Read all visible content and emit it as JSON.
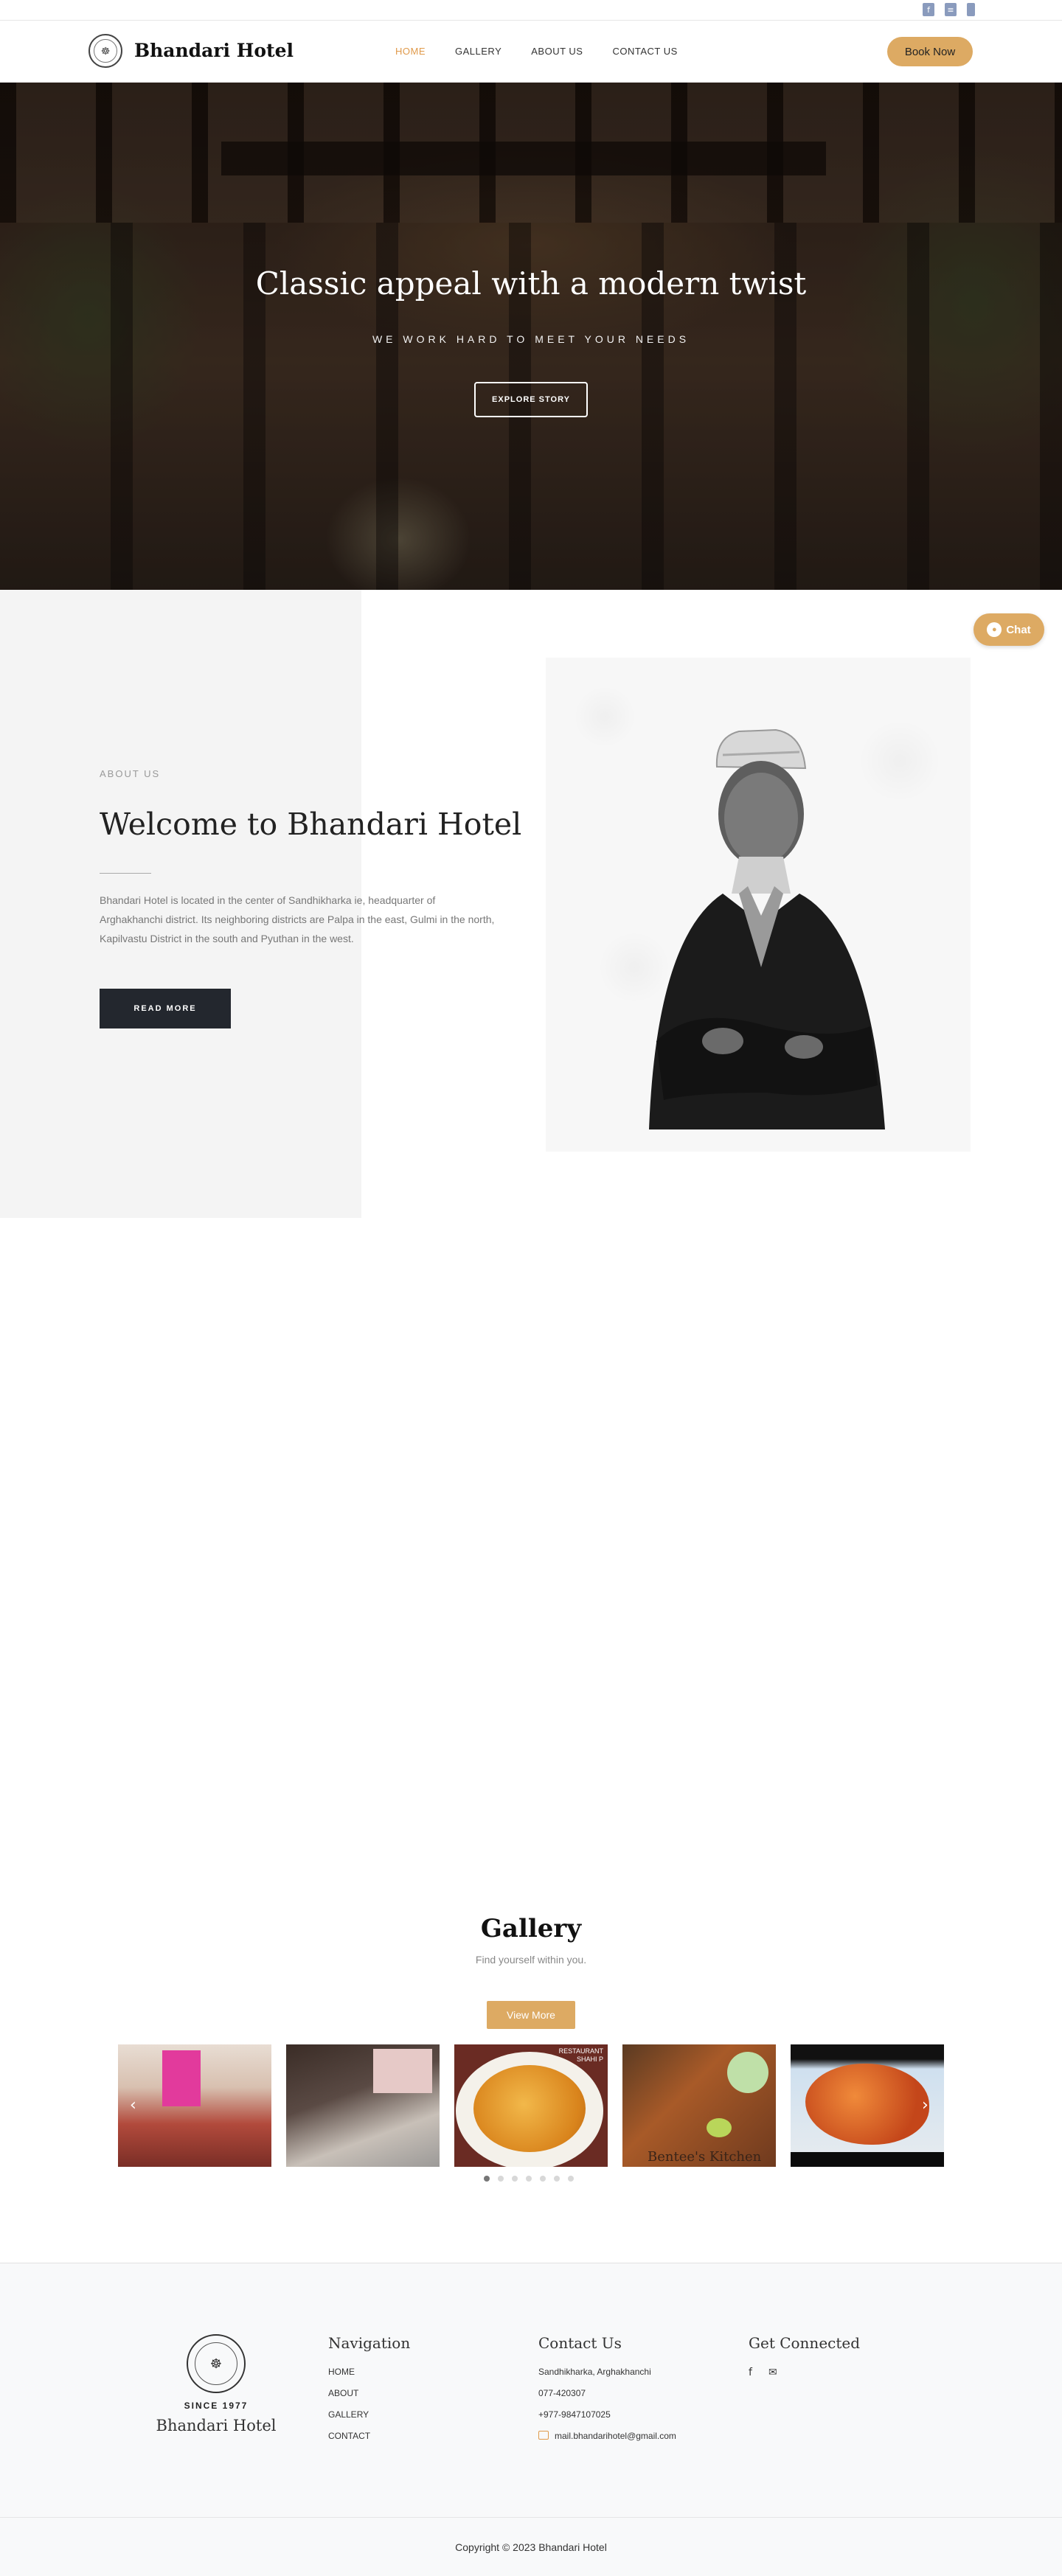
{
  "topbar": {
    "social": [
      {
        "icon": "facebook-icon",
        "glyph": "f"
      },
      {
        "icon": "list-icon",
        "glyph": "≡"
      },
      {
        "icon": "phone-icon",
        "glyph": ""
      }
    ]
  },
  "header": {
    "brand": "Bhandari Hotel",
    "nav": [
      "HOME",
      "GALLERY",
      "ABOUT US",
      "CONTACT US"
    ],
    "active_nav": "HOME",
    "book_label": "Book Now"
  },
  "hero": {
    "title": "Classic appeal with a modern twist",
    "subtitle": "WE WORK HARD TO MEET YOUR NEEDS",
    "button": "EXPLORE STORY"
  },
  "chat": {
    "label": "Chat"
  },
  "about": {
    "label": "ABOUT US",
    "title": "Welcome to Bhandari Hotel",
    "text": "Bhandari Hotel is located in the center of Sandhikharka ie, headquarter of Arghakhanchi district. Its neighboring districts are Palpa in the east, Gulmi in the north, Kapilvastu District in the south and Pyuthan in the west.",
    "button": "READ MORE"
  },
  "gallery": {
    "title": "Gallery",
    "subtitle": "Find yourself within you.",
    "button": "View More",
    "img3_tag": "RESTAURANT\nSHAHI P",
    "img4_caption": "Bentee's Kitchen",
    "dots": 7,
    "active_dot": 0
  },
  "footer": {
    "since": "SINCE 1977",
    "brand": "Bhandari Hotel",
    "nav_title": "Navigation",
    "nav_items": [
      "HOME",
      "ABOUT",
      "GALLERY",
      "CONTACT"
    ],
    "contact_title": "Contact Us",
    "contact_items": [
      "Sandhikharka, Arghakhanchi",
      "077-420307",
      "+977-9847107025",
      "mail.bhandarihotel@gmail.com"
    ],
    "social_title": "Get Connected",
    "social_icons": [
      "facebook-icon",
      "envelope-icon"
    ],
    "copyright": "Copyright © 2023 Bhandari Hotel"
  },
  "colors": {
    "accent": "#ddaa63",
    "active_nav": "#e09a4b",
    "dark_button": "#23272e"
  }
}
